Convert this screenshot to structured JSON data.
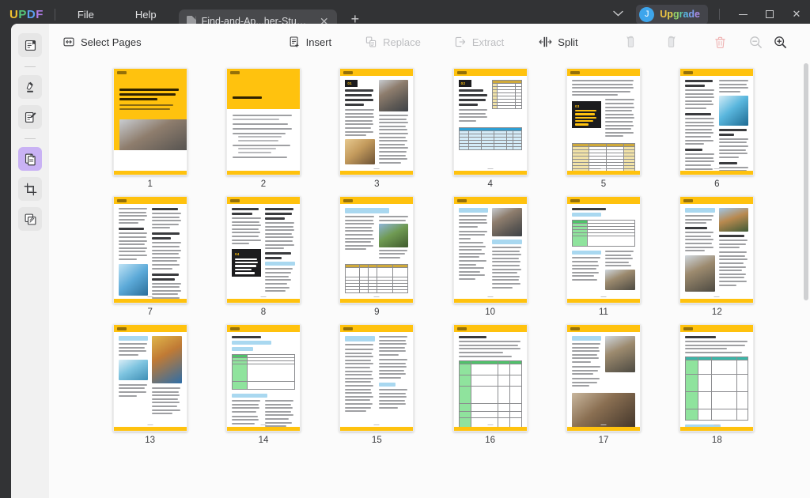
{
  "titlebar": {
    "logo": "UPDF",
    "logo_letters": [
      "U",
      "P",
      "D",
      "F"
    ],
    "menus": [
      {
        "label": "File",
        "name": "menu-file"
      },
      {
        "label": "Help",
        "name": "menu-help"
      }
    ],
    "tab": {
      "label": "Find-and-Ap...her-Studies",
      "close_label": "✕",
      "icon": "pdf-document-icon"
    },
    "new_tab_label": "+",
    "chevron_label": "⌄",
    "upgrade_label": "Upgrade",
    "upgrade_letters": [
      "U",
      "p",
      "g",
      "r",
      "a",
      "d",
      "e"
    ],
    "avatar_initial": "J",
    "window_buttons": {
      "minimize": "minimize-icon",
      "maximize": "maximize-icon",
      "close": "✕"
    }
  },
  "rail": {
    "items": [
      {
        "label": "Reader",
        "icon": "reader-view-icon",
        "active": false
      },
      {
        "label": "Annotate Highlighter",
        "icon": "highlighter-pen-icon",
        "active": false
      },
      {
        "label": "Edit PDF",
        "icon": "edit-document-icon",
        "active": false
      },
      {
        "label": "Organize Pages",
        "icon": "organize-pages-icon",
        "active": true
      },
      {
        "label": "Crop Pages",
        "icon": "crop-page-icon",
        "active": false
      },
      {
        "label": "Stamp",
        "icon": "stamp-pages-icon",
        "active": false
      }
    ]
  },
  "toolbar": {
    "select_pages": {
      "label": "Select Pages",
      "icon": "select-pages-icon",
      "enabled": true
    },
    "insert": {
      "label": "Insert",
      "icon": "insert-page-icon",
      "enabled": true
    },
    "replace": {
      "label": "Replace",
      "icon": "replace-page-icon",
      "enabled": false
    },
    "extract": {
      "label": "Extract",
      "icon": "extract-page-icon",
      "enabled": false
    },
    "split": {
      "label": "Split",
      "icon": "split-pages-icon",
      "enabled": true
    },
    "rotate_left": {
      "label": "Rotate Left",
      "icon": "rotate-left-icon",
      "enabled": false
    },
    "rotate_right": {
      "label": "Rotate Right",
      "icon": "rotate-right-icon",
      "enabled": false
    },
    "delete": {
      "label": "Delete",
      "icon": "trash-delete-icon",
      "enabled": false
    },
    "zoom_out": {
      "label": "Zoom Out",
      "icon": "zoom-out-icon",
      "enabled": false
    },
    "zoom_in": {
      "label": "Zoom In",
      "icon": "zoom-in-icon",
      "enabled": true
    }
  },
  "colors": {
    "brand_yellow": "#FFC20E",
    "accent_purple": "#c9b2f4",
    "avatar_blue": "#3da5ec",
    "delete_red": "#e8a0a0",
    "titlebar_bg": "#323335",
    "panel_bg": "#fbfbfb",
    "rail_bg": "#f1f1f1"
  },
  "pages": [
    {
      "number": "1",
      "type": "cover",
      "title": "Find and Apply For the Best Institutes In The World For Your Higher Studies"
    },
    {
      "number": "2",
      "type": "toc",
      "title": "Table of Contents"
    },
    {
      "number": "3",
      "type": "chapter-photo",
      "chapter": "01",
      "title": "Understanding the Need to Apply Internationally For Higher Studies"
    },
    {
      "number": "4",
      "type": "chapter-table-blue",
      "chapter": "02",
      "title": "The 10 Best Global Universities Leading the World Education"
    },
    {
      "number": "5",
      "type": "chapter-table-yellow",
      "chapter": "03",
      "title": "Looking Into the Top 10 Subject Majors That Feature the Best Professional Exposure"
    },
    {
      "number": "6",
      "type": "text-photo-med",
      "title": ""
    },
    {
      "number": "7",
      "type": "text-photo-left",
      "title": ""
    },
    {
      "number": "8",
      "type": "chapter-split",
      "chapter": "04",
      "title": "Scholarship Rules - An Overview and How to Apply For One in Your Favorite Institution"
    },
    {
      "number": "9",
      "type": "table-yellow-photo",
      "title": ""
    },
    {
      "number": "10",
      "type": "text-photo-right",
      "title": ""
    },
    {
      "number": "11",
      "type": "table-green-castle",
      "title": "University of Cambridge"
    },
    {
      "number": "12",
      "type": "text-photos-two",
      "title": ""
    },
    {
      "number": "13",
      "type": "photo-duo",
      "title": ""
    },
    {
      "number": "14",
      "type": "table-green-wide",
      "title": ""
    },
    {
      "number": "15",
      "type": "text-dense",
      "title": ""
    },
    {
      "number": "16",
      "type": "table-green-full",
      "title": ""
    },
    {
      "number": "17",
      "type": "photo-stack",
      "title": ""
    },
    {
      "number": "18",
      "type": "table-teal",
      "title": ""
    }
  ]
}
